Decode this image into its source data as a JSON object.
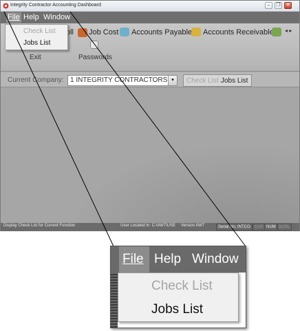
{
  "window": {
    "title": "Integrity Contractor Accounting Dashboard",
    "minimize": "–",
    "restore": "❐",
    "close": "✕"
  },
  "menu": {
    "file": "File",
    "help": "Help",
    "window": "Window"
  },
  "file_menu": {
    "check_list": "Check List",
    "jobs_list": "Jobs List",
    "check_list_enabled": false
  },
  "toolbar": {
    "payroll_fragment": "oll",
    "job_cost": "Job Cost",
    "accounts_payable": "Accounts Payable",
    "accounts_receivable": "Accounts Receivable",
    "exit": "Exit",
    "passwords": "Passwords",
    "scroll_arrows": "◂ ▸"
  },
  "company": {
    "label": "Current Company:",
    "value": "1 INTEGRITY CONTRACTORS, I",
    "arrow": "▾",
    "check_list_button": "Check List",
    "jobs_list_button": "Jobs List"
  },
  "status": {
    "message": "Display Check List for Current Function",
    "user_location": "User Located In: C:\\AW7\\USE",
    "version": "Version AW7",
    "serial": "Serial No. INTCO",
    "cap": "CAP",
    "num": "NUM",
    "scrl": "SCRL"
  },
  "colors": {
    "workspace": "#a6a6a6",
    "menubar": "#6f6f6f",
    "statusbar": "#6b6b6b"
  }
}
